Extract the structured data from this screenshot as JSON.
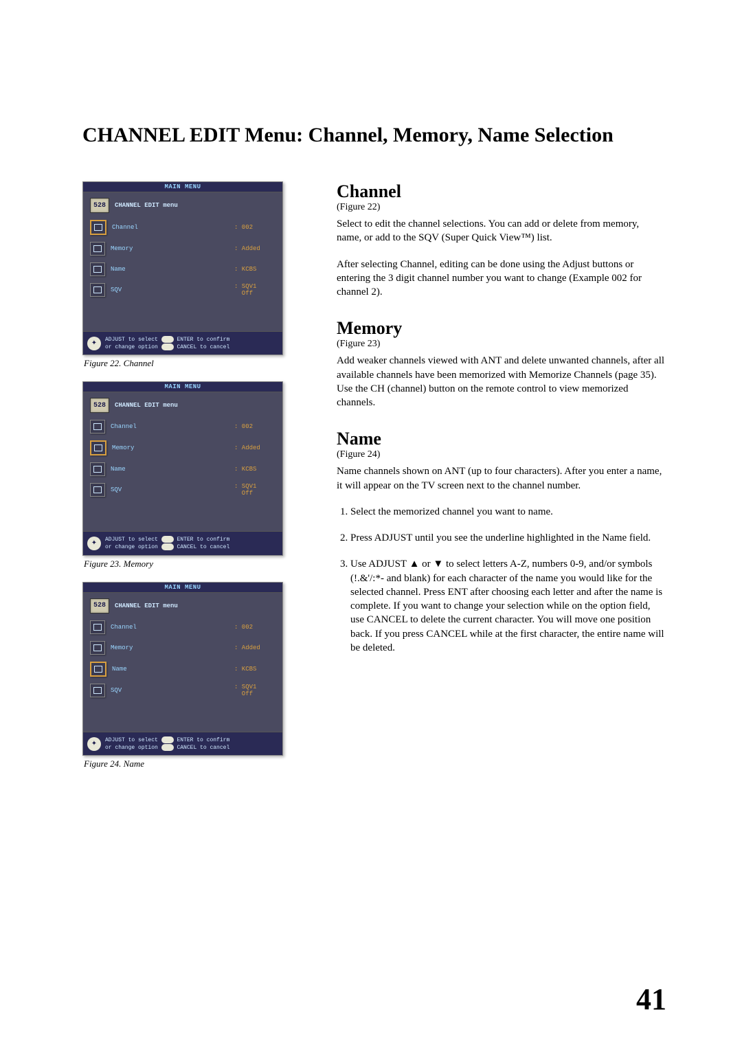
{
  "page_title": "CHANNEL EDIT Menu: Channel, Memory, Name Selection",
  "page_number": "41",
  "tv_menu_shared": {
    "main_title": "MAIN MENU",
    "submenu_title": "CHANNEL EDIT menu",
    "icon528": "528",
    "rows": [
      {
        "label": "Channel",
        "value": ": 002"
      },
      {
        "label": "Memory",
        "value": ": Added"
      },
      {
        "label": "Name",
        "value": ": KCBS"
      },
      {
        "label": "SQV",
        "value": ": SQV1\n  Off"
      }
    ],
    "footer_line1a": "ADJUST to select",
    "footer_line1b": "ENTER to confirm",
    "footer_line2a": "or change option",
    "footer_line2b": "CANCEL to cancel"
  },
  "figures": [
    {
      "caption": "Figure 22.  Channel",
      "selected_index": 0
    },
    {
      "caption": "Figure 23.  Memory",
      "selected_index": 1
    },
    {
      "caption": "Figure 24.  Name",
      "selected_index": 2
    }
  ],
  "sections": {
    "channel": {
      "title": "Channel",
      "sub": "(Figure 22)",
      "p1": "Select to edit the channel selections.  You can add or delete from memory, name, or add to the SQV (Super Quick View™) list.",
      "p2": "After selecting Channel, editing can be done using the Adjust buttons or entering the 3 digit channel number you want to change (Example 002 for channel 2)."
    },
    "memory": {
      "title": "Memory",
      "sub": "(Figure 23)",
      "p1": "Add weaker channels viewed with ANT and delete unwanted channels, after all available channels have been memorized with Memorize Channels (page 35). Use the CH (channel) button on the remote control to view memorized channels."
    },
    "name": {
      "title": "Name",
      "sub": "(Figure 24)",
      "p1": "Name channels shown on ANT (up to four characters).  After you enter a name, it will appear on the TV screen next to the channel number.",
      "steps": [
        "Select the memorized channel you want to name.",
        "Press ADJUST until you see the underline highlighted in the Name field.",
        "Use ADJUST ▲ or ▼ to select letters A-Z, numbers 0-9, and/or symbols (!.&'/:*- and blank) for each character of the name you would like for the selected channel.  Press ENT after choosing each letter and after the name is complete. If you want to change your selection while on the option field, use CANCEL to delete the current character. You will move one position back.  If you press CANCEL while at the first character, the entire name will be deleted."
      ]
    }
  }
}
